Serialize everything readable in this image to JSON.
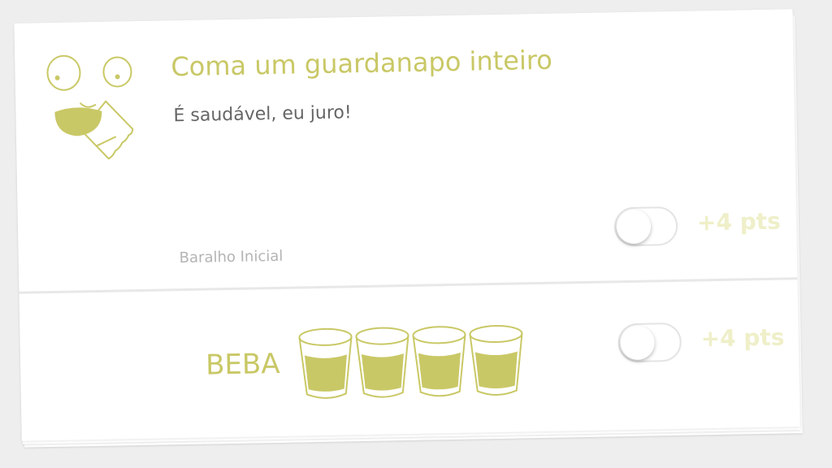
{
  "card": {
    "title": "Coma um guardanapo inteiro",
    "subtitle": "É saudável, eu juro!",
    "deck_name": "Baralho Inicial",
    "face_icon": "napkin-eating-face-icon",
    "points": {
      "toggle_on": false,
      "label": "+4 pts"
    }
  },
  "drink": {
    "label": "BEBA",
    "shots": [
      "shot-glass-icon",
      "shot-glass-icon",
      "shot-glass-icon",
      "shot-glass-icon"
    ],
    "points": {
      "toggle_on": false,
      "label": "+4 pts"
    }
  },
  "colors": {
    "accent": "#c9c866",
    "text_gray": "#666666",
    "muted": "#b4b4b4",
    "points_text": "#efefc9",
    "background": "#eeeeee"
  }
}
